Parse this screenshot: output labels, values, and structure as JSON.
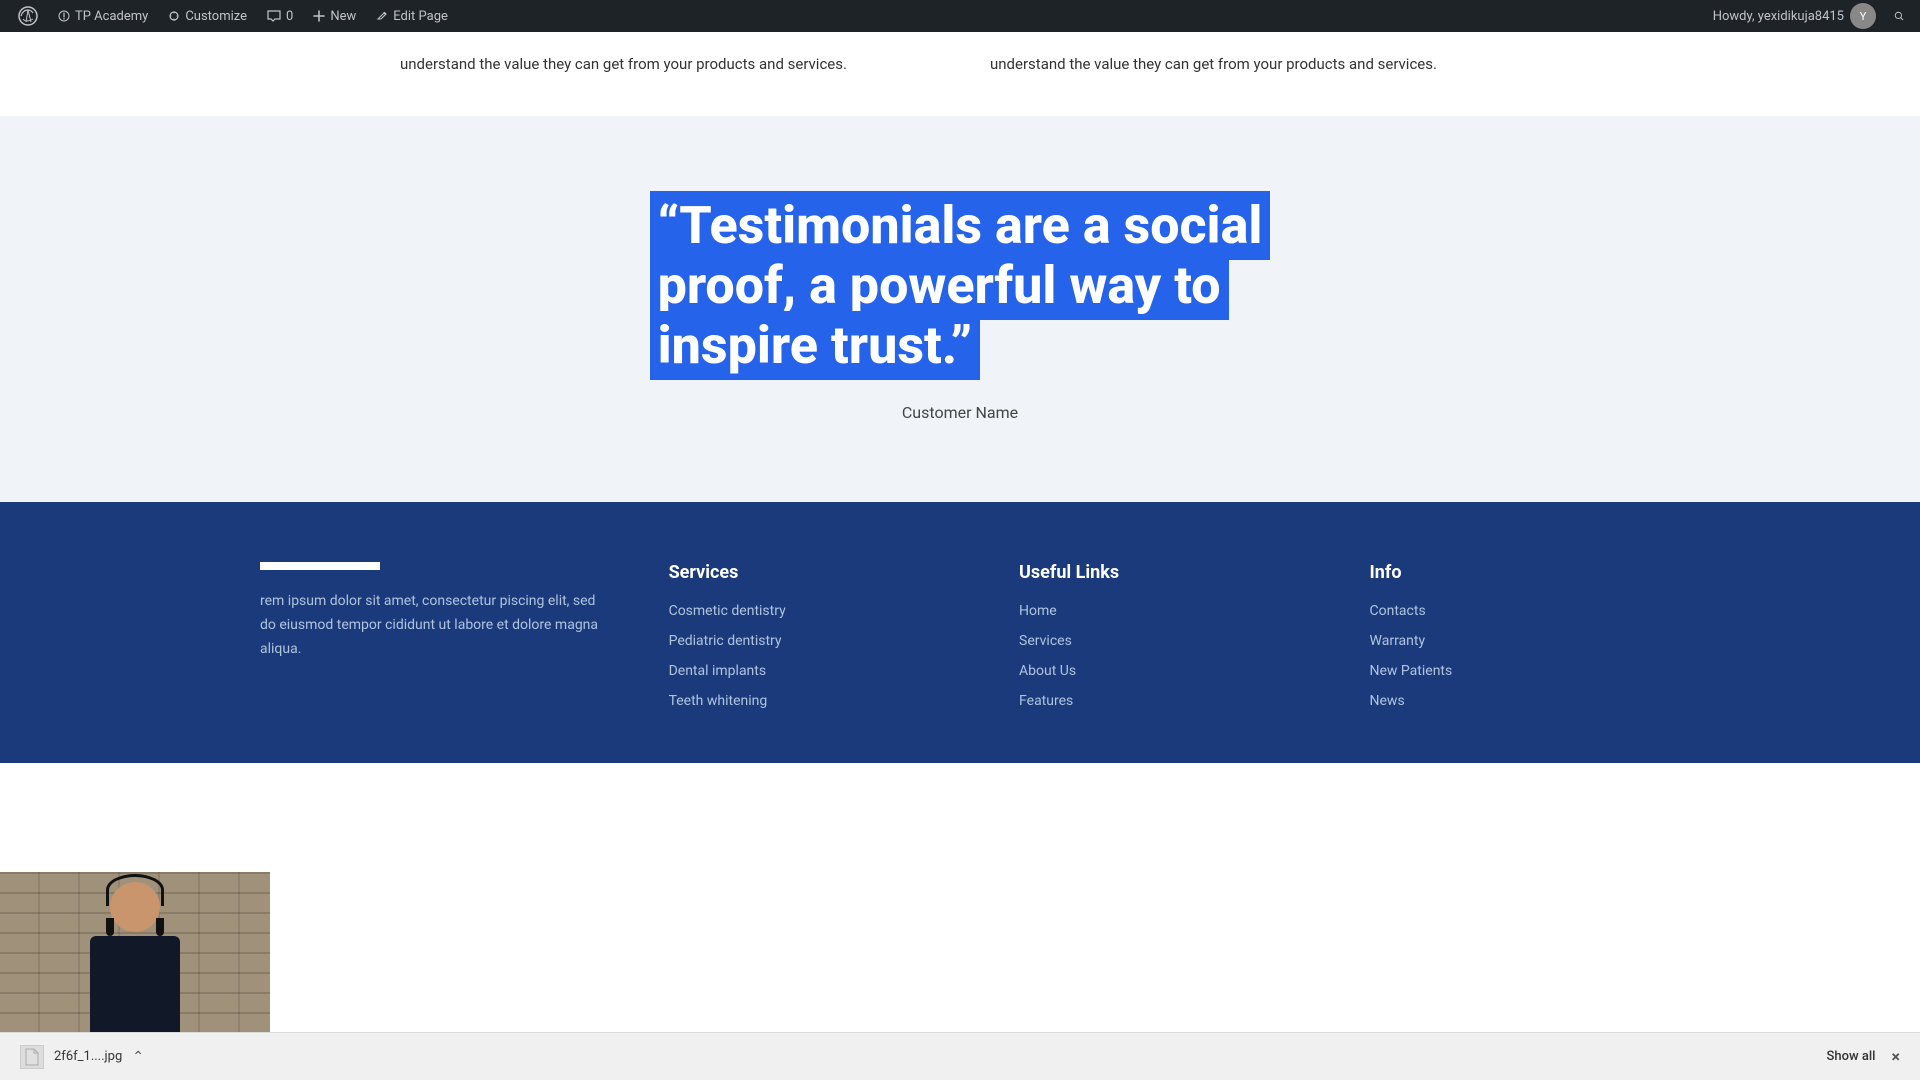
{
  "adminbar": {
    "wp_icon": "W",
    "site_name": "TP Academy",
    "customize": "Customize",
    "comments_label": "0",
    "new_label": "New",
    "edit_page": "Edit Page",
    "howdy": "Howdy, yexidikuja8415",
    "search_title": "Search"
  },
  "top_section": {
    "col1_text": "understand the value they can get from your products and services.",
    "col2_text": "understand the value they can get from your products and services."
  },
  "testimonial": {
    "quote": "“Testimonials are a social proof, a powerful way to inspire trust.”",
    "quote_line1": "“Testimonials are a social",
    "quote_line2": "proof, a powerful way to",
    "quote_line3": "inspire trust.”",
    "customer_name": "Customer Name"
  },
  "footer": {
    "logo_alt": "Logo",
    "description": "rem ipsum dolor sit amet, consectetur piscing elit, sed do eiusmod tempor cididunt ut labore et dolore magna aliqua.",
    "services": {
      "title": "Services",
      "links": [
        "Cosmetic dentistry",
        "Pediatric dentistry",
        "Dental implants",
        "Teeth whitening"
      ]
    },
    "useful_links": {
      "title": "Useful Links",
      "links": [
        "Home",
        "Services",
        "About Us",
        "Features"
      ]
    },
    "info": {
      "title": "Info",
      "links": [
        "Contacts",
        "Warranty",
        "New Patients",
        "News"
      ]
    }
  },
  "download_bar": {
    "filename": "2f6f_1....jpg",
    "show_all": "Show all",
    "close_label": "×"
  }
}
